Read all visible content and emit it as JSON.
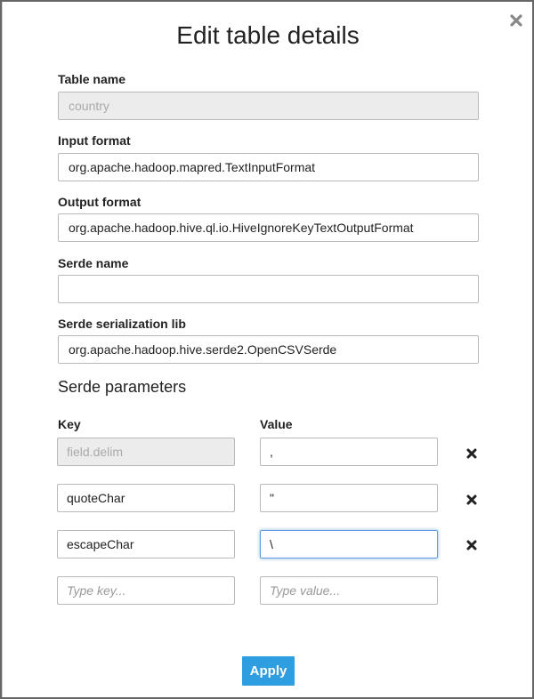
{
  "modal": {
    "title": "Edit table details",
    "close_icon": "close-icon"
  },
  "fields": {
    "table_name": {
      "label": "Table name",
      "value": "country",
      "disabled": true
    },
    "input_format": {
      "label": "Input format",
      "value": "org.apache.hadoop.mapred.TextInputFormat"
    },
    "output_format": {
      "label": "Output format",
      "value": "org.apache.hadoop.hive.ql.io.HiveIgnoreKeyTextOutputFormat"
    },
    "serde_name": {
      "label": "Serde name",
      "value": ""
    },
    "serde_lib": {
      "label": "Serde serialization lib",
      "value": "org.apache.hadoop.hive.serde2.OpenCSVSerde"
    }
  },
  "serde_params": {
    "title": "Serde parameters",
    "key_header": "Key",
    "value_header": "Value",
    "rows": [
      {
        "key": "field.delim",
        "value": ",",
        "key_disabled": true
      },
      {
        "key": "quoteChar",
        "value": "\""
      },
      {
        "key": "escapeChar",
        "value": "\\",
        "value_focused": true
      }
    ],
    "new_row": {
      "key_placeholder": "Type key...",
      "value_placeholder": "Type value..."
    },
    "remove_icon": "remove-icon"
  },
  "actions": {
    "apply_label": "Apply"
  },
  "colors": {
    "accent": "#2e9ee0",
    "focus": "#5d9ddf",
    "disabled_bg": "#ececec"
  }
}
